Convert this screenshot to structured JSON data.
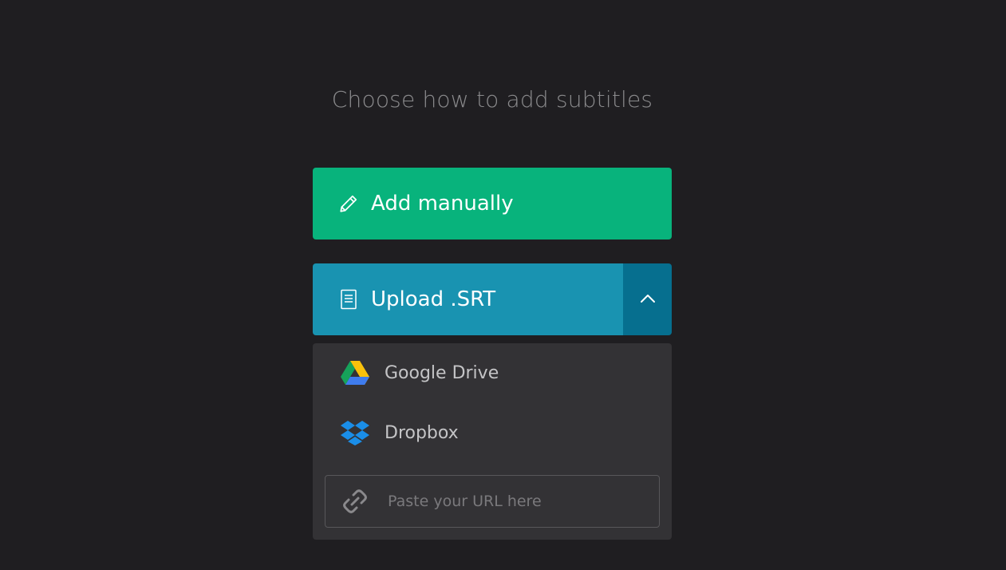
{
  "heading": "Choose how to add subtitles",
  "actions": {
    "add_manually": {
      "label": "Add manually",
      "icon": "pencil-icon",
      "color": "#08b37c"
    },
    "upload_srt": {
      "label": "Upload .SRT",
      "icon": "document-icon",
      "color": "#1993b1",
      "toggle_icon": "chevron-up-icon",
      "toggle_color": "#066f8f"
    }
  },
  "dropdown": {
    "items": [
      {
        "label": "Google Drive",
        "icon": "google-drive-icon"
      },
      {
        "label": "Dropbox",
        "icon": "dropbox-icon"
      }
    ],
    "url_input": {
      "placeholder": "Paste your URL here",
      "value": "",
      "icon": "link-icon"
    }
  }
}
